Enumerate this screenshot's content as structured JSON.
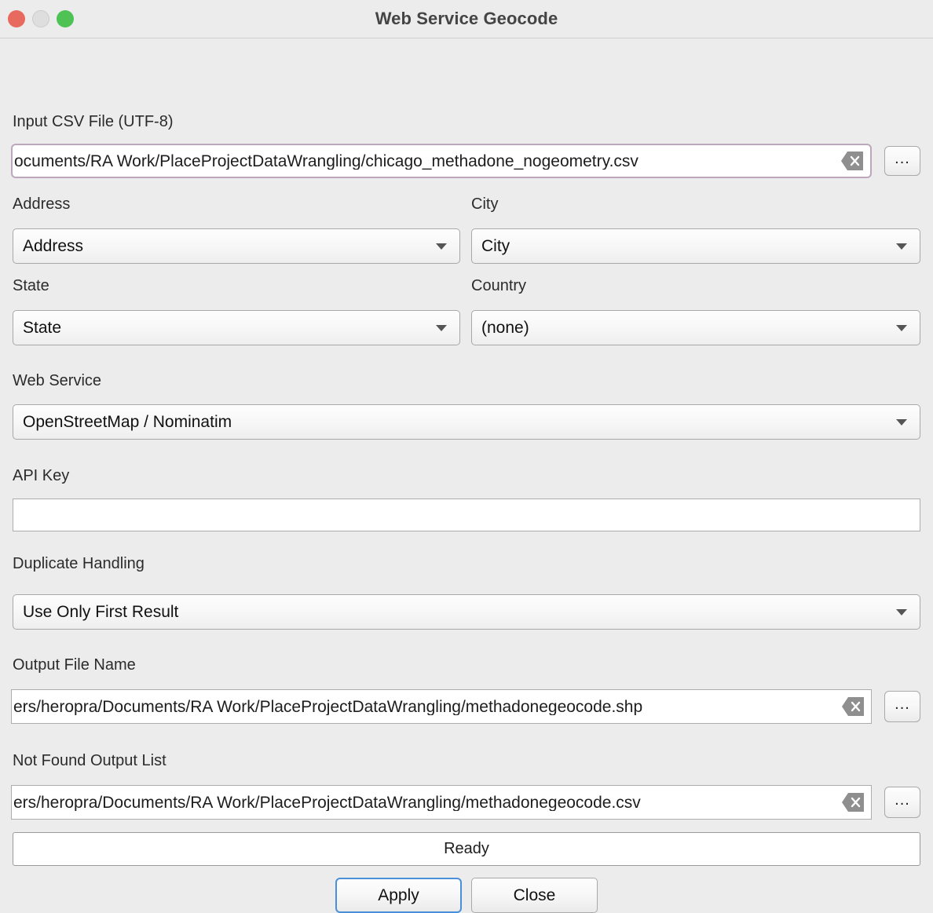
{
  "window": {
    "title": "Web Service Geocode",
    "traffic_lights": [
      {
        "name": "close",
        "color": "#e8695e"
      },
      {
        "name": "minimize",
        "color": "#dedede"
      },
      {
        "name": "zoom",
        "color": "#4ec254"
      }
    ]
  },
  "accent": {
    "focus_border": "#bda7bd",
    "primary_button_border": "#4a90d9",
    "background": "#ececec"
  },
  "fields": {
    "input_csv": {
      "label": "Input CSV File (UTF-8)",
      "value": "ocuments/RA Work/PlaceProjectDataWrangling/chicago_methadone_nogeometry.csv",
      "placeholder": "",
      "clear_icon": "clear-icon",
      "browse_label": "..."
    },
    "address": {
      "label": "Address",
      "value": "Address",
      "options": [
        "Address"
      ]
    },
    "city": {
      "label": "City",
      "value": "City",
      "options": [
        "City"
      ]
    },
    "state": {
      "label": "State",
      "value": "State",
      "options": [
        "State"
      ]
    },
    "country": {
      "label": "Country",
      "value": "(none)",
      "options": [
        "(none)"
      ]
    },
    "web_service": {
      "label": "Web Service",
      "value": "OpenStreetMap / Nominatim",
      "options": [
        "OpenStreetMap / Nominatim"
      ]
    },
    "api_key": {
      "label": "API Key",
      "value": "",
      "placeholder": ""
    },
    "duplicate_handling": {
      "label": "Duplicate Handling",
      "value": "Use Only First Result",
      "options": [
        "Use Only First Result"
      ]
    },
    "output_file": {
      "label": "Output File Name",
      "value": "ers/heropra/Documents/RA Work/PlaceProjectDataWrangling/methadonegeocode.shp",
      "placeholder": "",
      "clear_icon": "clear-icon",
      "browse_label": "..."
    },
    "not_found_output": {
      "label": "Not Found Output List",
      "value": "ers/heropra/Documents/RA Work/PlaceProjectDataWrangling/methadonegeocode.csv",
      "placeholder": "",
      "clear_icon": "clear-icon",
      "browse_label": "..."
    }
  },
  "status": {
    "text": "Ready"
  },
  "buttons": {
    "apply": "Apply",
    "close": "Close"
  }
}
